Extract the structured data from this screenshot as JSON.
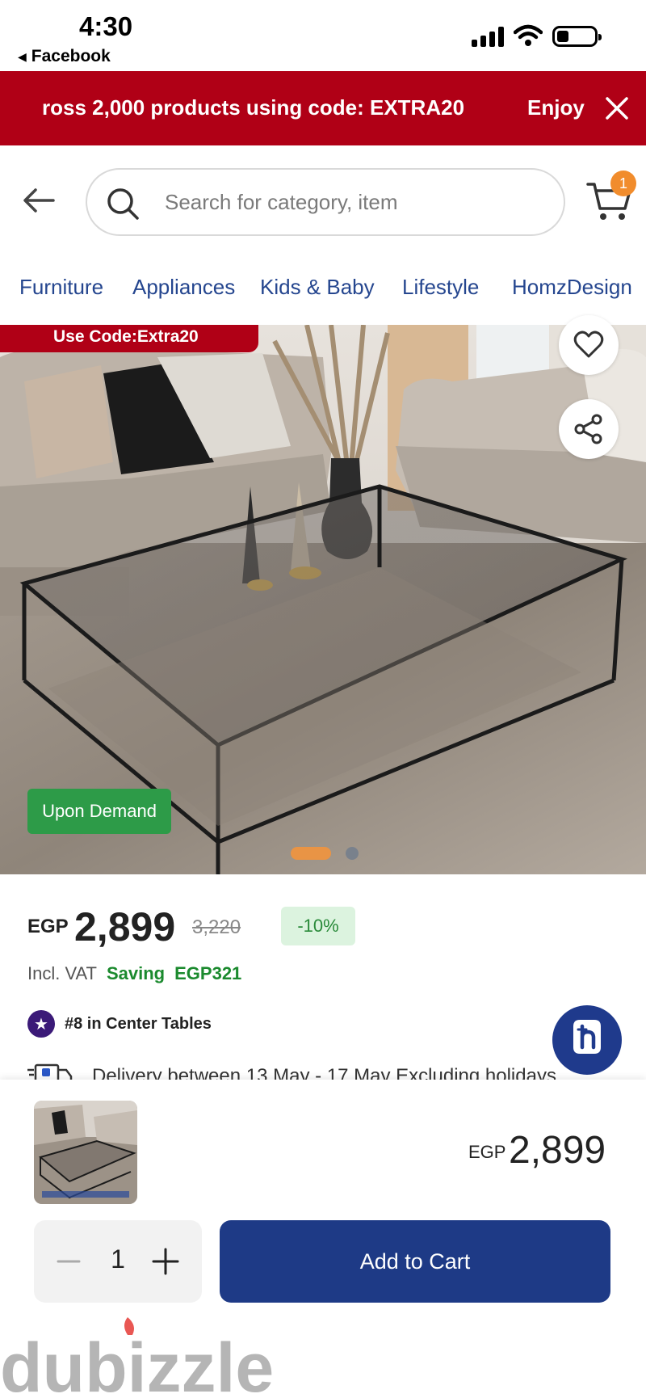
{
  "status_bar": {
    "time": "4:30",
    "back_app": "Facebook"
  },
  "promo": {
    "text": "ross 2,000 products using code: EXTRA20",
    "enjoy": "Enjoy",
    "close_icon": "close-icon",
    "color": "#b00016"
  },
  "header": {
    "search_placeholder": "Search for category, item",
    "cart_count": "1"
  },
  "categories": [
    "Furniture",
    "Appliances",
    "Kids & Baby",
    "Lifestyle",
    "HomzDesign"
  ],
  "product": {
    "promo_tag": "Use Code:Extra20",
    "availability": "Upon Demand",
    "carousel_active_index": 1,
    "carousel_total": 2,
    "currency": "EGP",
    "price": "2,899",
    "old_price": "3,220",
    "discount": "-10%",
    "vat_label": "Incl. VAT",
    "saving_label": "Saving",
    "saving_value": "EGP321",
    "rank": "#8 in Center Tables",
    "delivery": "Delivery between  13 May - 17 May Excluding holidays"
  },
  "bottom_bar": {
    "currency": "EGP",
    "price": "2,899",
    "quantity": "1",
    "add_to_cart": "Add to Cart",
    "button_color": "#1e3a86"
  },
  "watermark": "dubizzle"
}
